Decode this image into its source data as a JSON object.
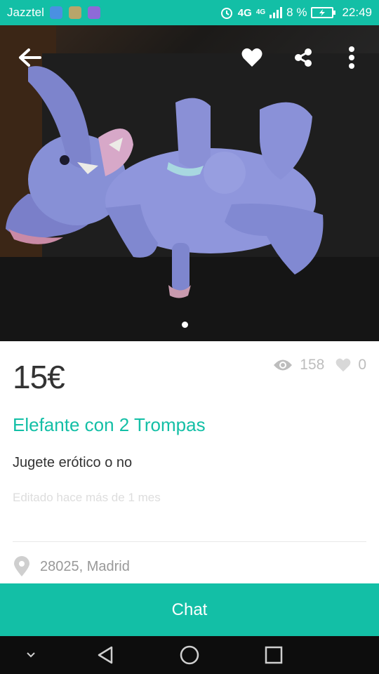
{
  "status_bar": {
    "carrier": "Jazztel",
    "network": "4G",
    "network_small": "4G",
    "battery": "8 %",
    "time": "22:49",
    "icons": [
      "location-icon",
      "map-icon",
      "gallery-icon",
      "alarm-icon",
      "signal-icon",
      "battery-icon"
    ]
  },
  "header": {
    "icons": [
      "back-arrow-icon",
      "heart-icon",
      "share-icon",
      "more-vertical-icon"
    ]
  },
  "gallery": {
    "image": "plush-elephant-photo",
    "pages": 1,
    "current_page": 1
  },
  "product": {
    "price": "15€",
    "views": "158",
    "favorites": "0",
    "title": "Elefante con 2 Trompas",
    "description": "Jugete erótico o no",
    "edited": "Editado hace más de 1 mes",
    "location": "28025, Madrid"
  },
  "chat": {
    "label": "Chat"
  },
  "nav": {
    "icons": [
      "chevron-down-icon",
      "back-triangle-icon",
      "home-circle-icon",
      "recents-square-icon"
    ]
  },
  "colors": {
    "accent": "#13bfa6",
    "text": "#333333",
    "muted": "#bdbdbd",
    "nav": "#0d0d0d"
  }
}
